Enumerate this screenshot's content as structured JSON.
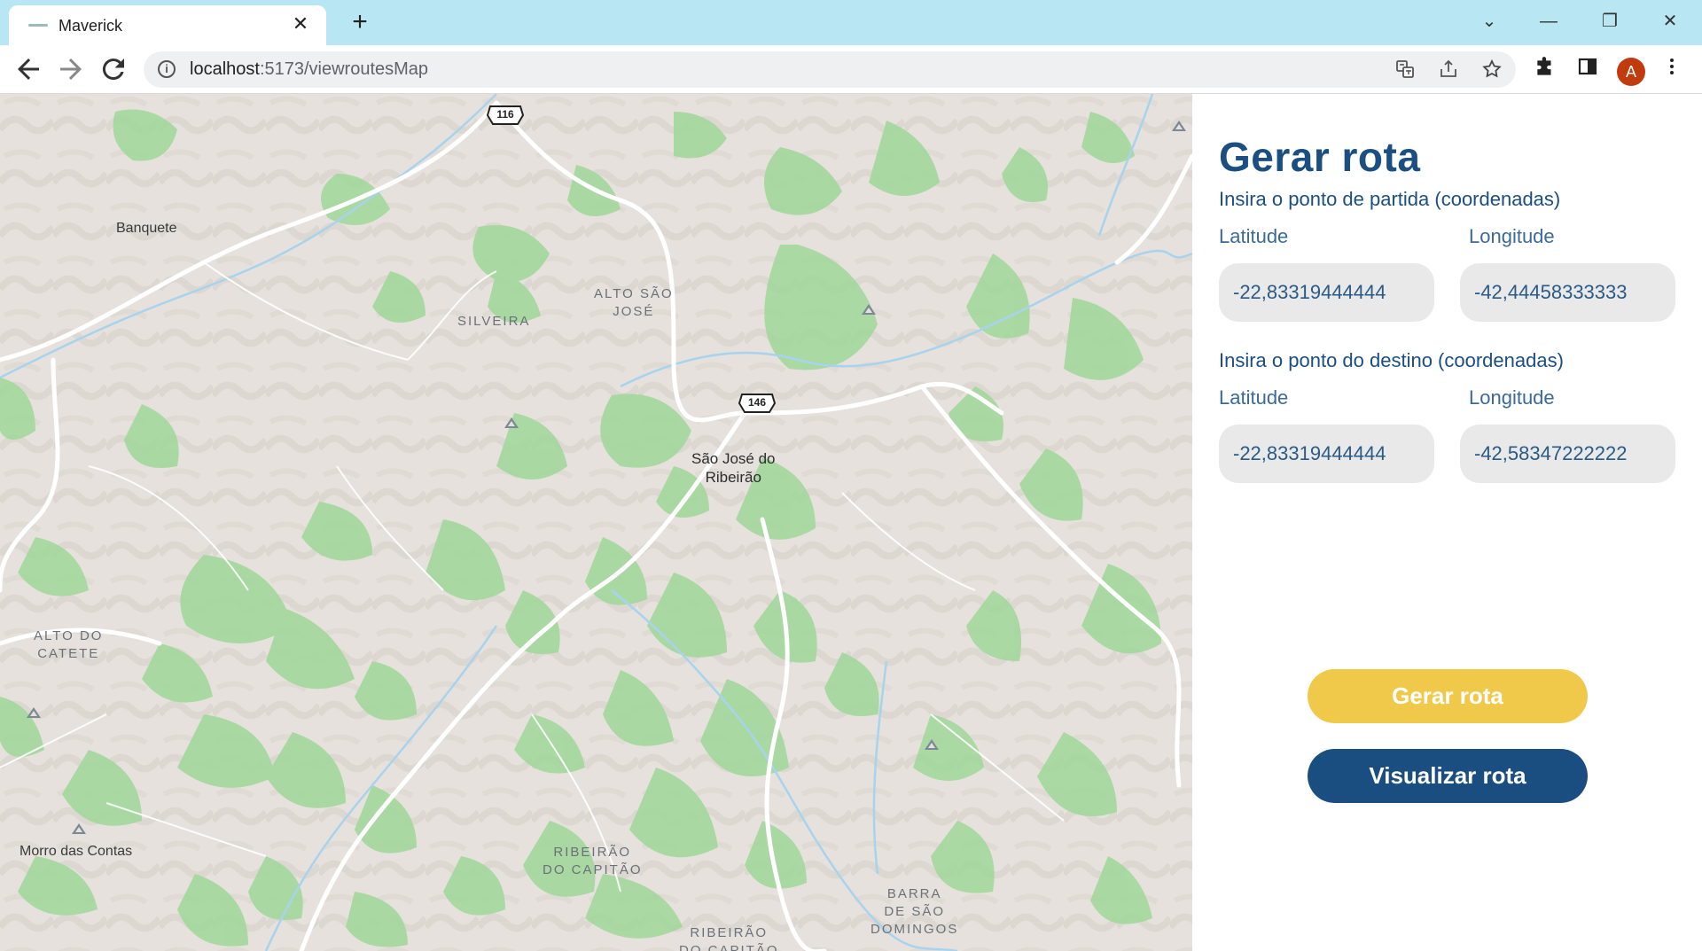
{
  "browser": {
    "tab_title": "Maverick",
    "tab_close": "✕",
    "new_tab": "+",
    "url_host": "localhost",
    "url_path": ":5173/viewroutesMap",
    "avatar_letter": "A",
    "window_controls": {
      "dropdown": "⌄",
      "minimize": "—",
      "restore": "❐",
      "close": "✕"
    },
    "icons": {
      "back": "arrow-left-icon",
      "forward": "arrow-right-icon",
      "reload": "reload-icon",
      "info": "info-icon",
      "translate": "translate-icon",
      "share": "share-icon",
      "bookmark": "star-icon",
      "extensions": "puzzle-icon",
      "sidepanel": "side-panel-icon",
      "menu": "kebab-menu-icon"
    }
  },
  "map": {
    "labels": {
      "banquete": "Banquete",
      "alto_sao_jose": "ALTO SÃO\nJOSÉ",
      "silveira": "SILVEIRA",
      "sao_jose_do_ribeirao": "São José do\nRibeirão",
      "alto_do_catete": "ALTO DO\nCATETE",
      "morro_das_contas": "Morro das Contas",
      "ribeirao_do_capitao": "RIBEIRÃO\nDO CAPITÃO",
      "barra_de_sao_domingos": "BARRA\nDE SÃO\nDOMINGOS",
      "ribeirao_do_capitao_2": "RIBEIRÃO\nDO CAPITÃO"
    },
    "shields": {
      "route_116": "116",
      "route_146": "146"
    },
    "colors": {
      "terrain": "#e6e1dc",
      "vegetation": "#9fd79a",
      "water": "#a8d3ee",
      "road": "#ffffff"
    }
  },
  "panel": {
    "title": "Gerar rota",
    "start_section": "Insira o ponto de partida (coordenadas)",
    "dest_section": "Insira o ponto do destino (coordenadas)",
    "lat_label": "Latitude",
    "lng_label": "Longitude",
    "start_lat": "-22,83319444444",
    "start_lng": "-42,44458333333",
    "dest_lat": "-22,83319444444",
    "dest_lng": "-42,58347222222",
    "generate_button": "Gerar rota",
    "view_button": "Visualizar rota",
    "colors": {
      "title": "#1b4f82",
      "generate": "#f1c94a",
      "view": "#1a4e80"
    }
  }
}
